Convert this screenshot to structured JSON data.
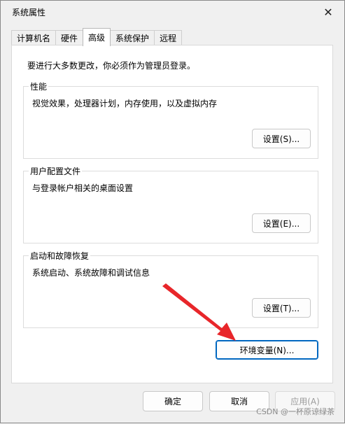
{
  "window": {
    "title": "系统属性"
  },
  "tabs": [
    {
      "label": "计算机名",
      "active": false
    },
    {
      "label": "硬件",
      "active": false
    },
    {
      "label": "高级",
      "active": true
    },
    {
      "label": "系统保护",
      "active": false
    },
    {
      "label": "远程",
      "active": false
    }
  ],
  "advanced": {
    "intro": "要进行大多数更改，你必须作为管理员登录。",
    "performance": {
      "title": "性能",
      "desc": "视觉效果，处理器计划，内存使用，以及虚拟内存",
      "button": "设置(S)..."
    },
    "user_profiles": {
      "title": "用户配置文件",
      "desc": "与登录帐户相关的桌面设置",
      "button": "设置(E)..."
    },
    "startup_recovery": {
      "title": "启动和故障恢复",
      "desc": "系统启动、系统故障和调试信息",
      "button": "设置(T)..."
    },
    "env_button": "环境变量(N)..."
  },
  "footer": {
    "ok": "确定",
    "cancel": "取消",
    "apply": "应用(A)"
  },
  "watermark": "CSDN @一杯原谅绿茶",
  "colors": {
    "arrow": "#e8262a",
    "accent": "#0067c0"
  }
}
